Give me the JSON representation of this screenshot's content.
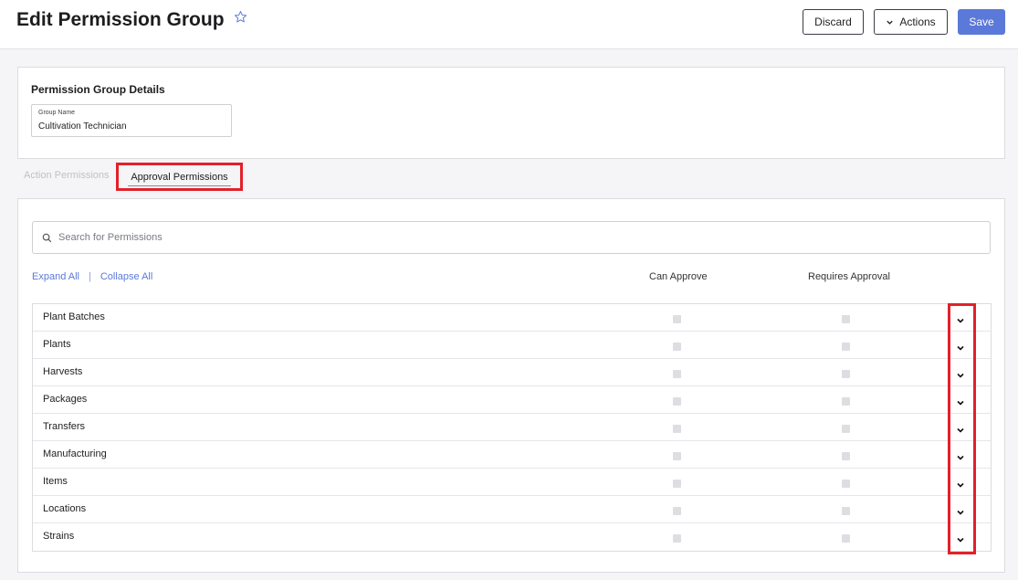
{
  "header": {
    "title": "Edit Permission Group",
    "discard_label": "Discard",
    "actions_label": "Actions",
    "save_label": "Save"
  },
  "details": {
    "section_title": "Permission Group Details",
    "group_name_label": "Group Name",
    "group_name_value": "Cultivation Technician"
  },
  "tabs": {
    "action_label": "Action Permissions",
    "approval_label": "Approval Permissions"
  },
  "permissions": {
    "search_placeholder": "Search for Permissions",
    "expand_all": "Expand All",
    "separator": "|",
    "collapse_all": "Collapse All",
    "can_approve_header": "Can Approve",
    "requires_approval_header": "Requires Approval",
    "rows": [
      {
        "label": "Plant Batches"
      },
      {
        "label": "Plants"
      },
      {
        "label": "Harvests"
      },
      {
        "label": "Packages"
      },
      {
        "label": "Transfers"
      },
      {
        "label": "Manufacturing"
      },
      {
        "label": "Items"
      },
      {
        "label": "Locations"
      },
      {
        "label": "Strains"
      }
    ]
  },
  "colors": {
    "accent": "#5b79d8",
    "highlight": "#e3202a"
  }
}
